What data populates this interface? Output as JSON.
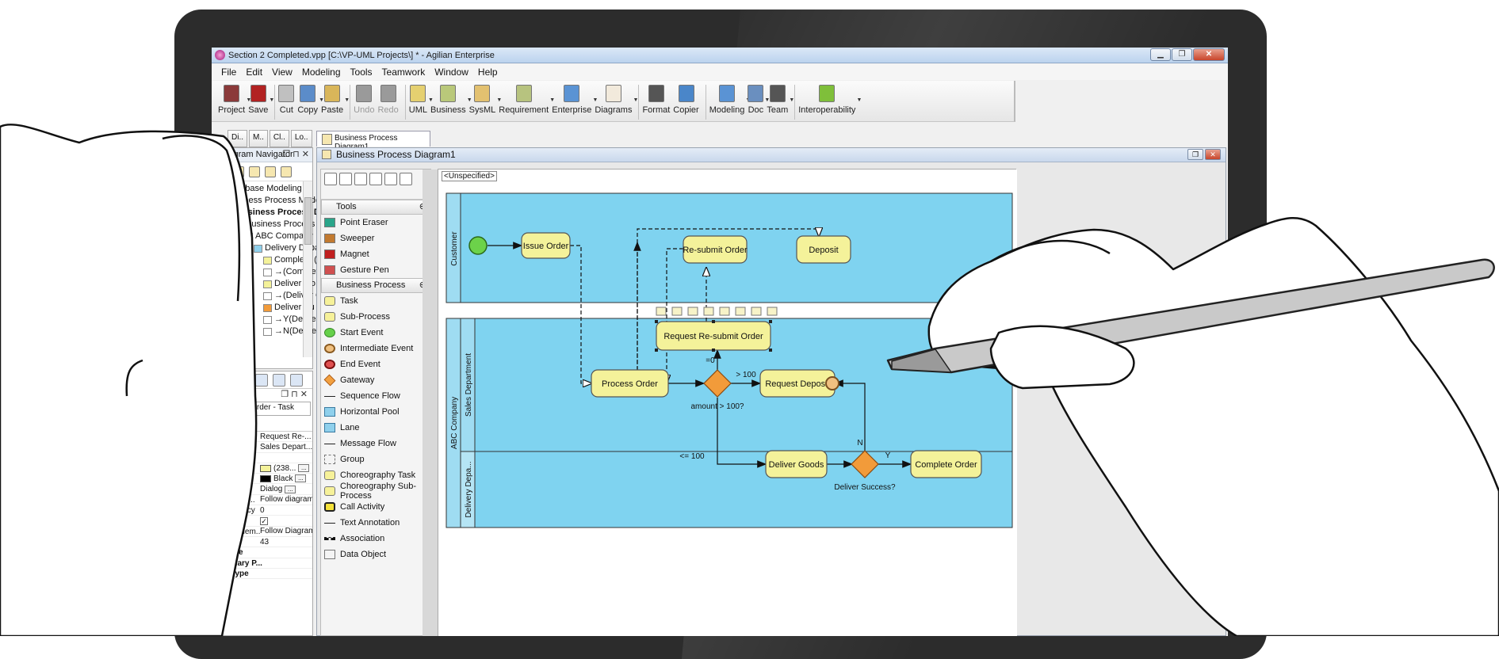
{
  "window": {
    "title": "Section 2 Completed.vpp [C:\\VP-UML Projects\\] * - Agilian Enterprise",
    "minimize": "▁",
    "restore": "❐",
    "close": "✕"
  },
  "menu": [
    "File",
    "Edit",
    "View",
    "Modeling",
    "Tools",
    "Teamwork",
    "Window",
    "Help"
  ],
  "toolbar": {
    "items": [
      {
        "label": "Project",
        "icon": "project-icon",
        "color": "#8b3a3a"
      },
      {
        "label": "Save",
        "icon": "save-icon",
        "color": "#b22222"
      },
      {
        "label": "Cut",
        "icon": "cut-icon",
        "color": "#c0c0c0"
      },
      {
        "label": "Copy",
        "icon": "copy-icon",
        "color": "#5b8cc9"
      },
      {
        "label": "Paste",
        "icon": "paste-icon",
        "color": "#d9b65a"
      },
      {
        "label": "Undo",
        "icon": "undo-icon",
        "color": "#9a9a9a"
      },
      {
        "label": "Redo",
        "icon": "redo-icon",
        "color": "#9a9a9a"
      },
      {
        "label": "UML",
        "icon": "uml-icon",
        "color": "#e5d070"
      },
      {
        "label": "Business",
        "icon": "business-icon",
        "color": "#b9c87a"
      },
      {
        "label": "SysML",
        "icon": "sysml-icon",
        "color": "#e3c170"
      },
      {
        "label": "Requirement",
        "icon": "requirement-icon",
        "color": "#b7c37f"
      },
      {
        "label": "Enterprise",
        "icon": "enterprise-icon",
        "color": "#5a93d4"
      },
      {
        "label": "Diagrams",
        "icon": "diagrams-icon",
        "color": "#f2eadc"
      },
      {
        "label": "Format",
        "icon": "format-icon",
        "color": "#555555"
      },
      {
        "label": "Copier",
        "icon": "copier-icon",
        "color": "#4a86c9"
      },
      {
        "label": "Modeling",
        "icon": "modeling-icon",
        "color": "#5a93d4"
      },
      {
        "label": "Doc",
        "icon": "doc-icon",
        "color": "#6a8fbf"
      },
      {
        "label": "Team",
        "icon": "team-icon",
        "color": "#555555"
      },
      {
        "label": "Interoperability",
        "icon": "interoperability-icon",
        "color": "#7fbf3a"
      }
    ]
  },
  "left_tabs": [
    "Di..",
    "M..",
    "Cl..",
    "Lo.."
  ],
  "navigator": {
    "title": "Diagram Navigator",
    "controls": "❐ ⊓ ✕",
    "tree": [
      {
        "label": "Database Modeling",
        "indent": 0,
        "bold": false
      },
      {
        "label": "Business Process Modeling",
        "indent": 0,
        "bold": false
      },
      {
        "label": "Business Process Diag",
        "indent": 1,
        "bold": true
      },
      {
        "label": "Business Process Diagr",
        "indent": 2,
        "bold": false
      },
      {
        "label": "ABC Company",
        "indent": 3,
        "bold": false
      },
      {
        "label": "Delivery Depar",
        "indent": 4,
        "bold": false
      },
      {
        "label": "Complete (",
        "indent": 5,
        "bold": false
      },
      {
        "label": "→(Complete",
        "indent": 5,
        "bold": false
      },
      {
        "label": "Deliver Go",
        "indent": 5,
        "bold": false
      },
      {
        "label": "→(Deliver Go",
        "indent": 5,
        "bold": false
      },
      {
        "label": "Deliver Su",
        "indent": 5,
        "bold": false
      },
      {
        "label": "→Y(Deliver S",
        "indent": 5,
        "bold": false
      },
      {
        "label": "→N(Deliver S",
        "indent": 5,
        "bold": false
      }
    ]
  },
  "properties": {
    "controls": "❐ ⊓ ✕",
    "selected": "e-submit Order - Task",
    "rows": [
      {
        "key": "",
        "value": "Request Re-..."
      },
      {
        "key": "",
        "value": "Sales Depart..."
      },
      {
        "key": "",
        "value": ""
      },
      {
        "key": "",
        "value": "(238..."
      },
      {
        "key": "",
        "value": "Black"
      },
      {
        "key": "t",
        "value": "Dialog"
      },
      {
        "key": "onnection...",
        "value": "Follow diagram"
      },
      {
        "key": "ansparency",
        "value": "0"
      },
      {
        "key": "paque",
        "value": "✓"
      },
      {
        "key": "Model Elem...",
        "value": "Follow Diagram"
      },
      {
        "key": "er ID",
        "value": "43"
      },
      {
        "key": "sk Type",
        "value": "",
        "bold": true
      },
      {
        "key": "econdary P...",
        "value": "",
        "bold": true
      },
      {
        "key": "oop Type",
        "value": "",
        "bold": true
      }
    ]
  },
  "doc_tab": "Business Process Diagram1",
  "diagram_window": {
    "title": "Business Process Diagram1",
    "unspecified": "<Unspecified>"
  },
  "palette": {
    "groups": [
      {
        "title": "Tools",
        "items": [
          "Point Eraser",
          "Sweeper",
          "Magnet",
          "Gesture Pen"
        ]
      },
      {
        "title": "Business Process",
        "items": [
          "Task",
          "Sub-Process",
          "Start Event",
          "Intermediate Event",
          "End Event",
          "Gateway",
          "Sequence Flow",
          "Horizontal Pool",
          "Lane",
          "Message Flow",
          "Group",
          "Choreography Task",
          "Choreography Sub-Process",
          "Call Activity",
          "Text Annotation",
          "Association",
          "Data Object"
        ]
      }
    ]
  },
  "bpmn": {
    "pool_customer": "Customer",
    "pool_abc": "ABC Company",
    "lane_customer": "Customer",
    "lane_sales": "Sales Department",
    "lane_delivery": "Delivery Depa...",
    "left_lane_sales": "Sales Department",
    "left_lane_delivery": "Delivery Department",
    "tasks": {
      "issue_order": "Issue Order",
      "resubmit_order": "Re-submit Order",
      "deposit": "Deposit",
      "request_resubmit": "Request Re-submit Order",
      "process_order": "Process Order",
      "request_deposit": "Request Deposit",
      "deliver_goods": "Deliver Goods",
      "complete_order": "Complete Order"
    },
    "gateways": {
      "amount": "amount > 100?",
      "deliver_success": "Deliver Success?"
    },
    "flow_labels": {
      "eq0": "=0",
      "gt100": "> 100",
      "le100": "<= 100",
      "y": "Y",
      "n": "N"
    },
    "colors": {
      "pool_fill": "#7fd3f0",
      "task_fill": "#f4f29a",
      "gateway_fill": "#f29b3a",
      "start_fill": "#6cd24a"
    }
  }
}
